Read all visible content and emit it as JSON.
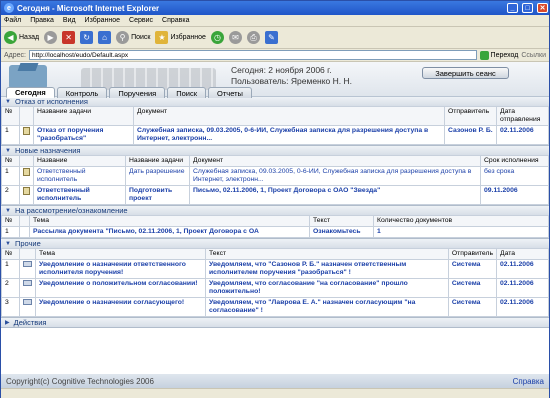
{
  "window": {
    "title": "Сегодня - Microsoft Internet Explorer"
  },
  "menu": [
    "Файл",
    "Правка",
    "Вид",
    "Избранное",
    "Сервис",
    "Справка"
  ],
  "toolbar": {
    "back": "Назад",
    "search": "Поиск",
    "favorites": "Избранное"
  },
  "address": {
    "label": "Адрес:",
    "url": "http://localhost/eudo/Default.aspx",
    "go": "Переход",
    "links": "Ссылки"
  },
  "header": {
    "date_line": "Сегодня: 2 ноября 2006 г.",
    "user_line": "Пользователь: Яременко Н. Н.",
    "end_session": "Завершить сеанс"
  },
  "tabs": [
    "Сегодня",
    "Контроль",
    "Поручения",
    "Поиск",
    "Отчеты"
  ],
  "sec1": {
    "title": "Отказ от исполнения",
    "headers": [
      "№",
      "Название задачи",
      "Документ",
      "Отправитель",
      "Дата отправления"
    ],
    "rows": [
      {
        "n": "1",
        "task": "Отказ от поручения \"разобраться\"",
        "doc": "Служебная записка, 09.03.2005, 0-6-ИИ, Служебная записка для разрешения доступа в Интернет, электронн...",
        "sender": "Сазонов Р. Б.",
        "date": "02.11.2006"
      }
    ]
  },
  "sec2": {
    "title": "Новые назначения",
    "headers": [
      "№",
      "Название",
      "Название задачи",
      "Документ",
      "Срок исполнения"
    ],
    "rows": [
      {
        "n": "1",
        "name": "Ответственный исполнитель",
        "task": "Дать разрешение",
        "doc": "Служебная записка, 09.03.2005, 0-6-ИИ, Служебная записка для разрешения доступа в Интернет, электронн...",
        "due": "без срока"
      },
      {
        "n": "2",
        "name": "Ответственный исполнитель",
        "task": "Подготовить проект",
        "doc": "Письмо, 02.11.2006, 1, Проект Договора с ОАО \"Звезда\"",
        "due": "09.11.2006"
      }
    ]
  },
  "sec3": {
    "title": "На рассмотрение/ознакомление",
    "headers": [
      "№",
      "Тема",
      "Текст",
      "Количество документов"
    ],
    "rows": [
      {
        "n": "1",
        "topic": "Рассылка документа \"Письмо, 02.11.2006, 1, Проект Договора с ОА",
        "text": "Ознакомьтесь",
        "count": "1"
      }
    ]
  },
  "sec4": {
    "title": "Прочие",
    "headers": [
      "№",
      "Тема",
      "Текст",
      "Отправитель",
      "Дата"
    ],
    "rows": [
      {
        "n": "1",
        "topic": "Уведомление о назначении ответственного исполнителя поручения!",
        "text": "Уведомляем, что \"Сазонов Р. Б.\" назначен ответственным исполнителем поручения \"разобраться\" !",
        "sender": "Система",
        "date": "02.11.2006"
      },
      {
        "n": "2",
        "topic": "Уведомление о положительном согласовании!",
        "text": "Уведомляем, что согласование \"на согласование\" прошло положительно!",
        "sender": "Система",
        "date": "02.11.2006"
      },
      {
        "n": "3",
        "topic": "Уведомление о назначении согласующего!",
        "text": "Уведомляем, что \"Лаврова Е. А.\" назначен согласующим \"на согласование\" !",
        "sender": "Система",
        "date": "02.11.2006"
      }
    ]
  },
  "sec5": {
    "title": "Действия"
  },
  "footer": {
    "copyright": "Copyright(c) Cognitive Technologies 2006",
    "help": "Справка"
  }
}
